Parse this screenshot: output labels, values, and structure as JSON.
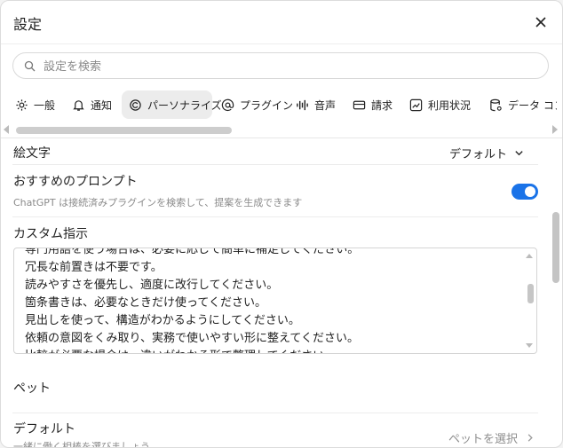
{
  "dialog": {
    "title": "設定"
  },
  "search": {
    "placeholder": "設定を検索"
  },
  "tabs": [
    {
      "label": "一般",
      "icon": "gear-icon"
    },
    {
      "label": "通知",
      "icon": "bell-icon"
    },
    {
      "label": "パーソナライズ",
      "icon": "personalize-icon",
      "active": true
    },
    {
      "label": "プラグイン",
      "icon": "at-icon"
    },
    {
      "label": "音声",
      "icon": "waveform-icon"
    },
    {
      "label": "請求",
      "icon": "card-icon"
    },
    {
      "label": "利用状況",
      "icon": "chart-icon"
    },
    {
      "label": "データ コントロール",
      "icon": "database-icon"
    }
  ],
  "emoji": {
    "label": "絵文字",
    "value": "デフォルト"
  },
  "prompts": {
    "label": "おすすめのプロンプト",
    "description": "ChatGPT は接続済みプラグインを検索して、提案を生成できます",
    "enabled": true
  },
  "custom": {
    "label": "カスタム指示",
    "lines": [
      "専門用語を使う場合は、必要に応じて簡単に補足してください。",
      "冗長な前置きは不要です。",
      "読みやすさを優先し、適度に改行してください。",
      "箇条書きは、必要なときだけ使ってください。",
      "見出しを使って、構造がわかるようにしてください。",
      "依頼の意図をくみ取り、実務で使いやすい形に整えてください。",
      "比較が必要な場合は、違いがわかる形で整理してください。"
    ]
  },
  "pet": {
    "section": "ペット",
    "label": "デフォルト",
    "description": "一緒に働く相棒を選びましょう",
    "select": "ペットを選択"
  },
  "colors": {
    "accent": "#1a73e8"
  }
}
